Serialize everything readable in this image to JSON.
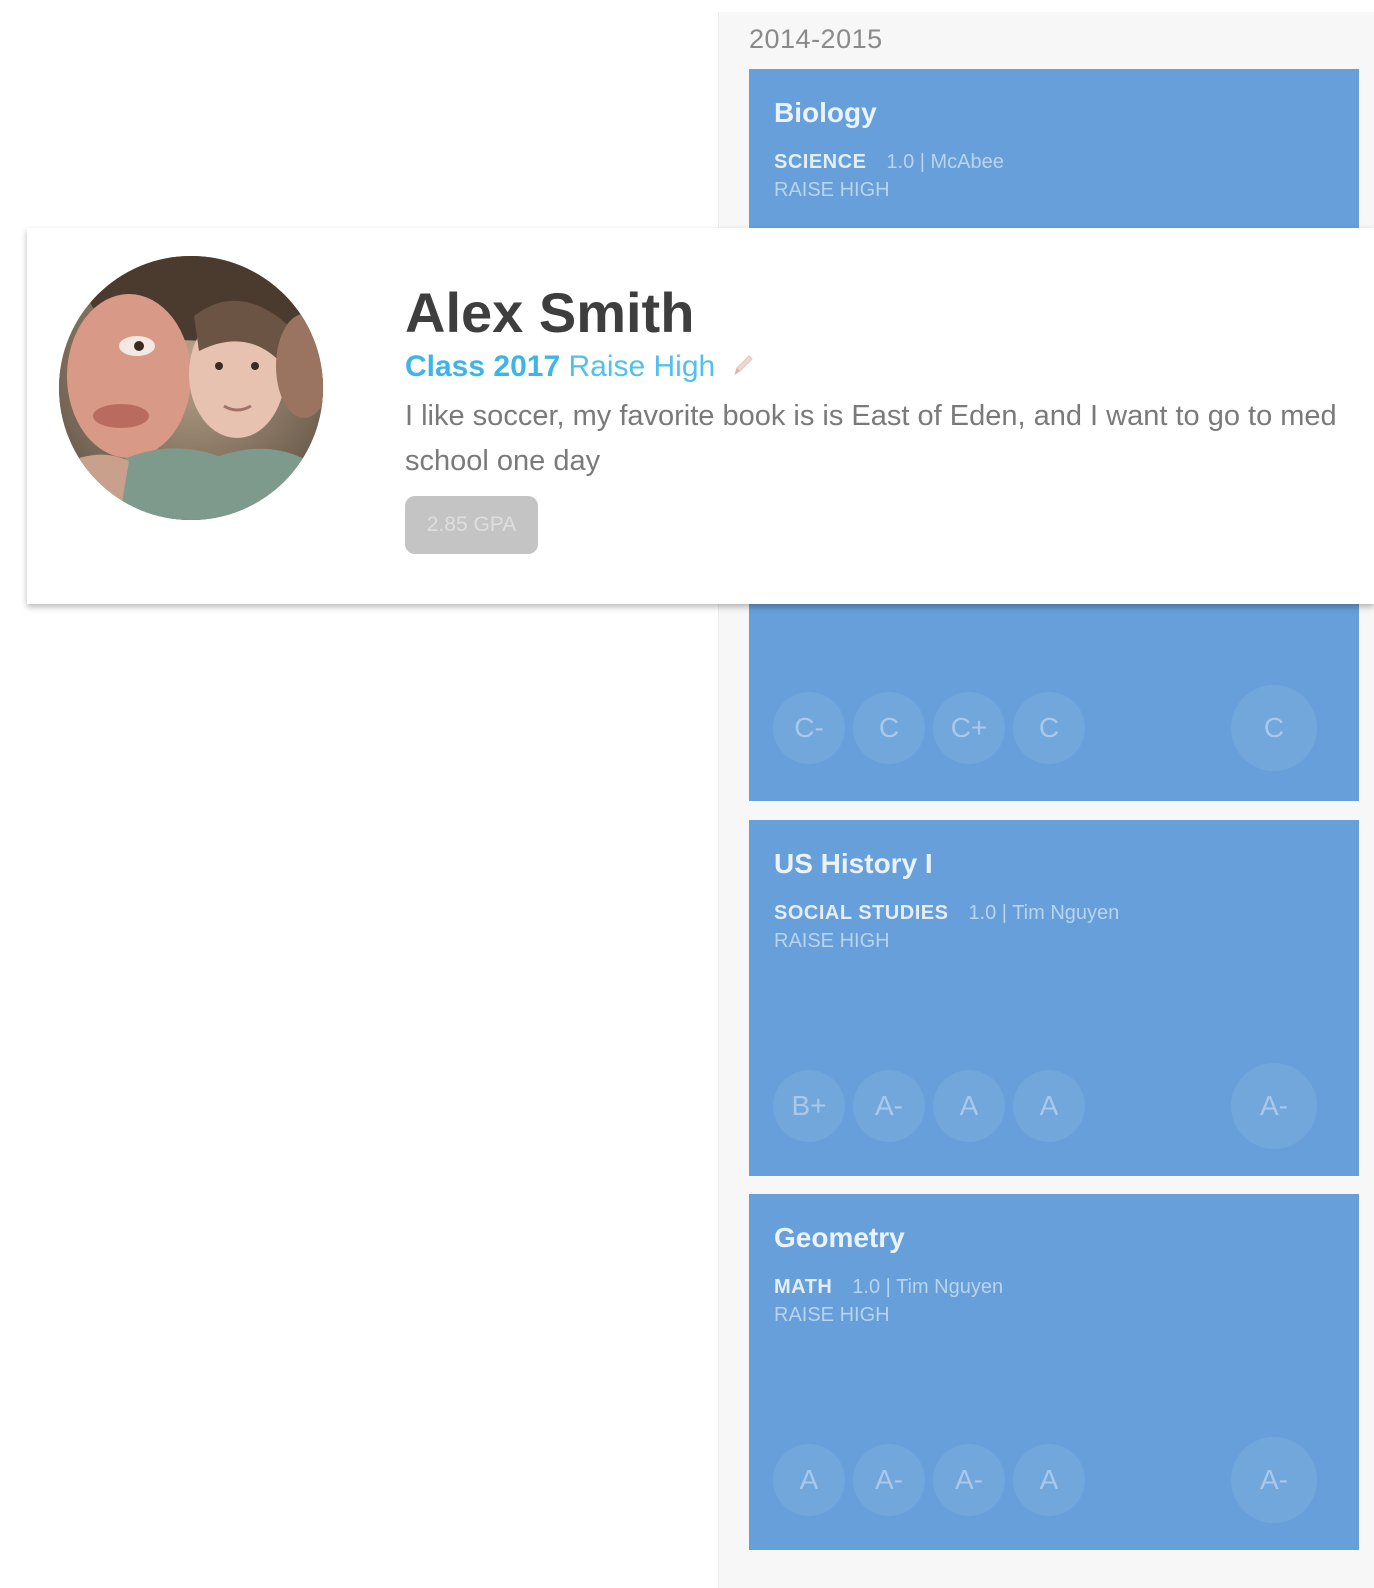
{
  "year": "2014-2015",
  "profile": {
    "name": "Alex Smith",
    "class_year": "Class 2017",
    "school": "Raise High",
    "bio": "I like soccer, my favorite book is is East of Eden, and I want to go to med school one day",
    "gpa": "2.85 GPA",
    "edit_icon": "pencil-icon"
  },
  "courses": [
    {
      "name": "Biology",
      "subject": "SCIENCE",
      "detail": "1.0 | McAbee",
      "school": "RAISE HIGH",
      "grades": [
        "C-",
        "C",
        "C+",
        "C"
      ],
      "final_grade": "C"
    },
    {
      "name": "US History I",
      "subject": "SOCIAL STUDIES",
      "detail": "1.0 | Tim Nguyen",
      "school": "RAISE HIGH",
      "grades": [
        "B+",
        "A-",
        "A",
        "A"
      ],
      "final_grade": "A-"
    },
    {
      "name": "Geometry",
      "subject": "MATH",
      "detail": "1.0 | Tim Nguyen",
      "school": "RAISE HIGH",
      "grades": [
        "A",
        "A-",
        "A-",
        "A"
      ],
      "final_grade": "A-"
    }
  ],
  "colors": {
    "course_card": "#669fd9",
    "class_year": "#3fb5e6",
    "gpa_badge": "#c4c4c4"
  }
}
